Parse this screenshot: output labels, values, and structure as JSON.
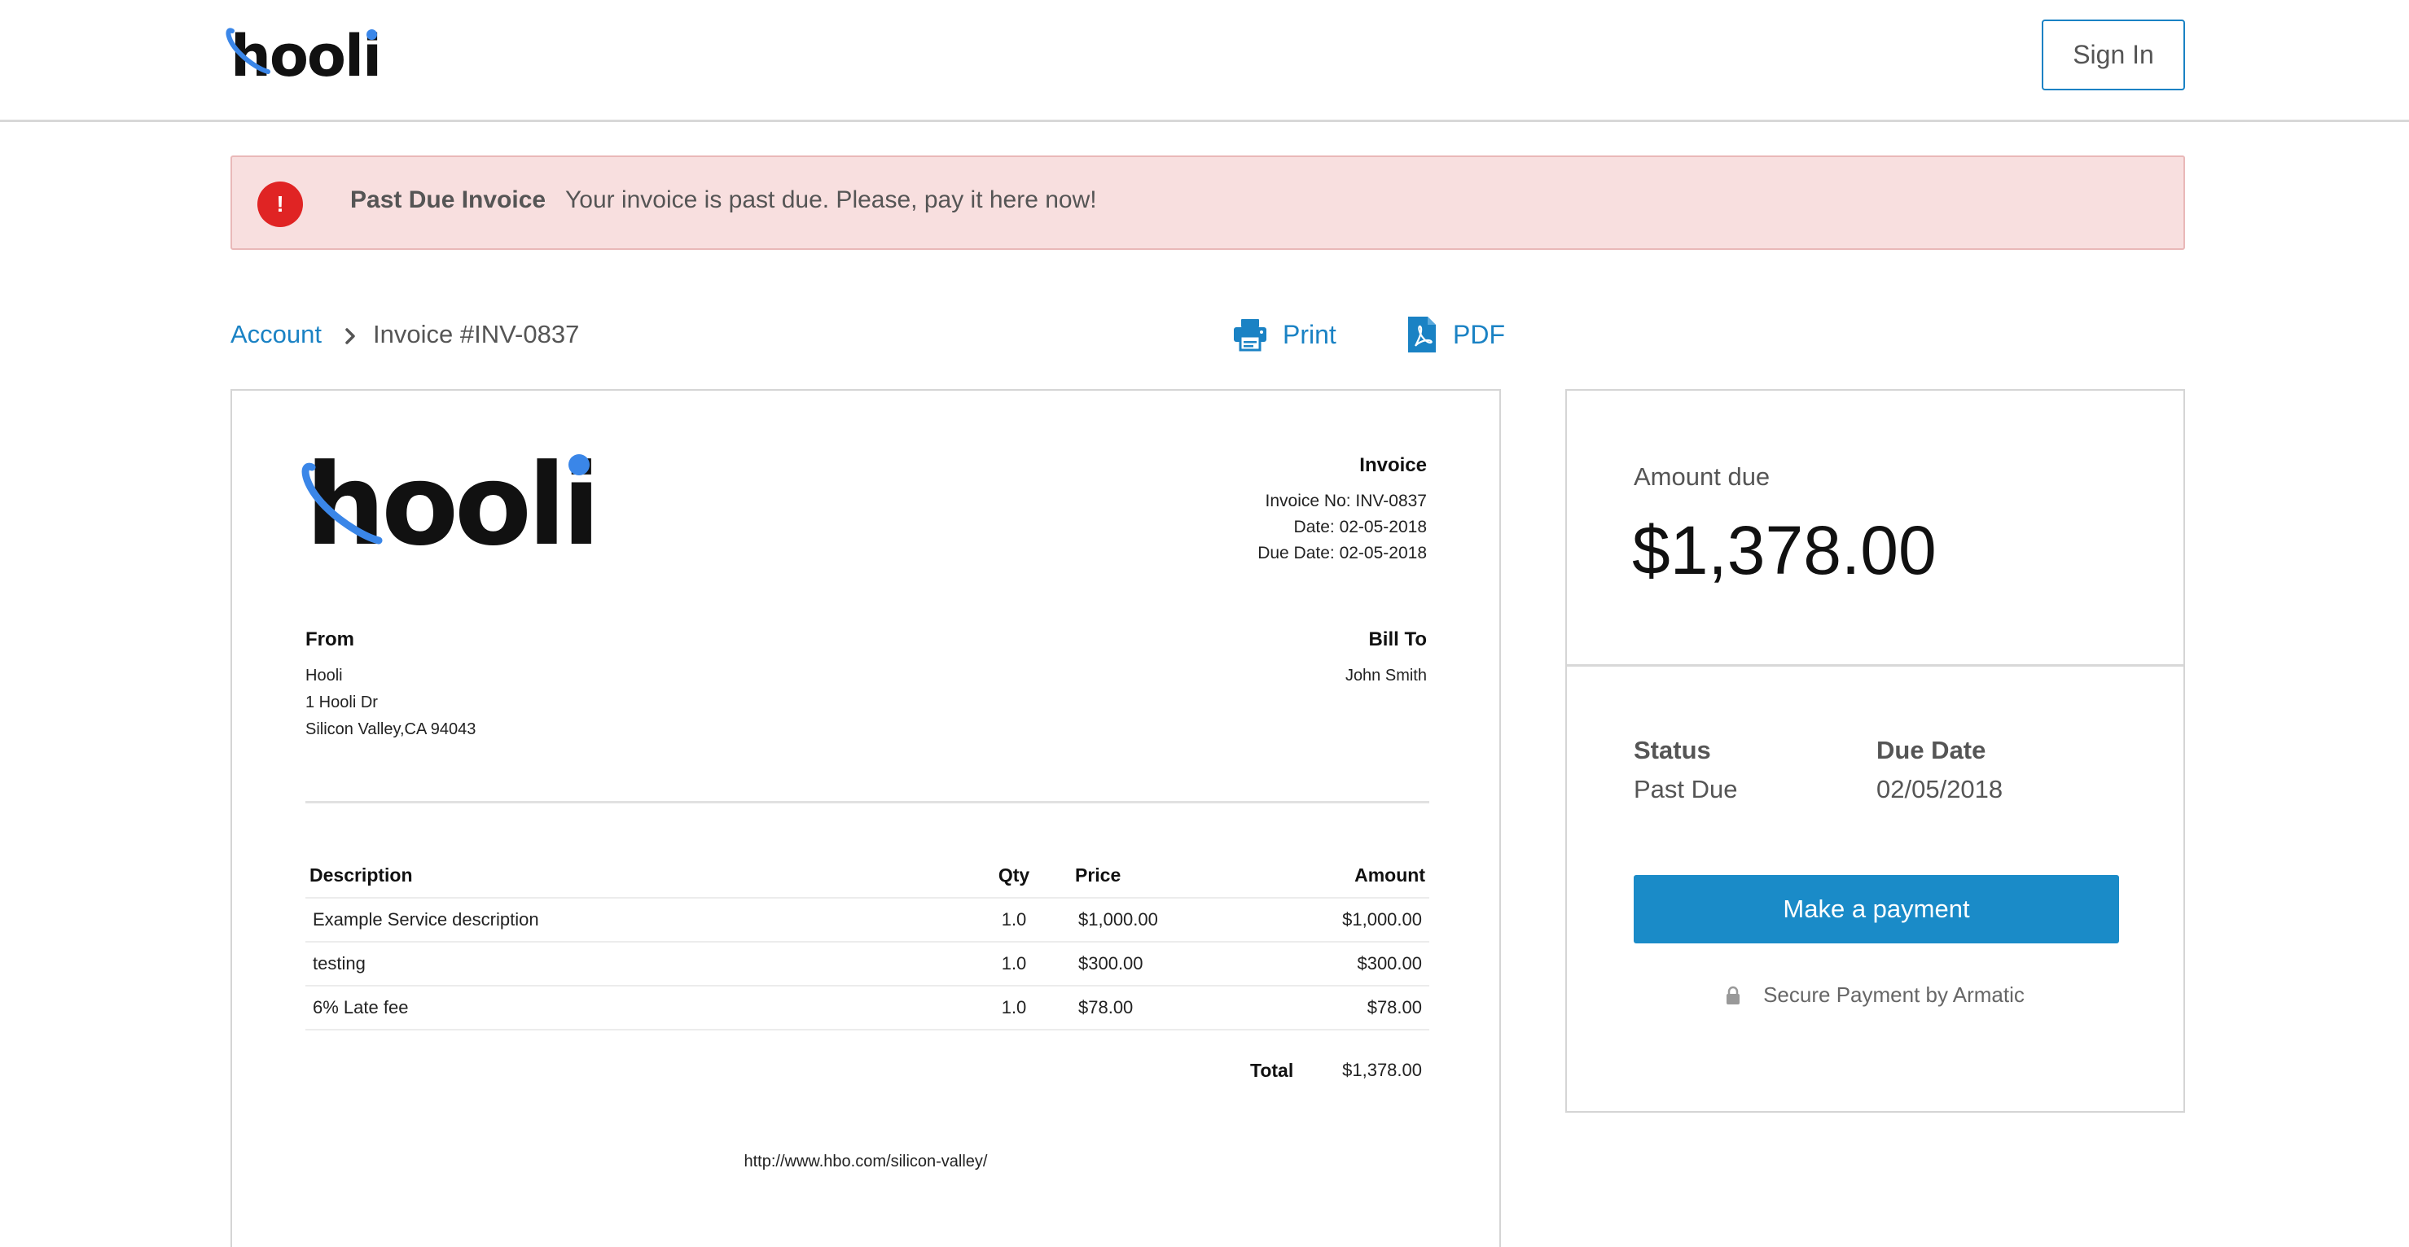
{
  "header": {
    "logo_text": "hooli",
    "sign_in_label": "Sign In"
  },
  "alert": {
    "icon_glyph": "!",
    "title": "Past Due Invoice",
    "message": "Your invoice is past due. Please, pay it here now!"
  },
  "breadcrumb": {
    "parent": "Account",
    "current": "Invoice #INV-0837"
  },
  "actions": {
    "print_label": "Print",
    "pdf_label": "PDF"
  },
  "invoice": {
    "logo_text": "hooli",
    "heading": "Invoice",
    "number_line": "Invoice No: INV-0837",
    "date_line": "Date: 02-05-2018",
    "due_date_line": "Due Date: 02-05-2018",
    "from": {
      "heading": "From",
      "name": "Hooli",
      "address1": "1 Hooli Dr",
      "address2": "Silicon Valley,CA 94043"
    },
    "bill_to": {
      "heading": "Bill To",
      "name": "John Smith"
    },
    "columns": {
      "description": "Description",
      "qty": "Qty",
      "price": "Price",
      "amount": "Amount"
    },
    "rows": [
      {
        "description": "Example Service description",
        "qty": "1.0",
        "price": "$1,000.00",
        "amount": "$1,000.00"
      },
      {
        "description": "testing",
        "qty": "1.0",
        "price": "$300.00",
        "amount": "$300.00"
      },
      {
        "description": "6% Late fee",
        "qty": "1.0",
        "price": "$78.00",
        "amount": "$78.00"
      }
    ],
    "total_label": "Total",
    "total_value": "$1,378.00",
    "footer_url": "http://www.hbo.com/silicon-valley/"
  },
  "payment": {
    "amount_label": "Amount due",
    "amount_value": "$1,378.00",
    "status_heading": "Status",
    "status_value": "Past Due",
    "due_date_heading": "Due Date",
    "due_date_value": "02/05/2018",
    "button_label": "Make a payment",
    "secure_text": "Secure Payment by Armatic"
  },
  "colors": {
    "accent": "#1a82c4",
    "button": "#1a8bc8",
    "alert_bg": "#f8dfdf",
    "alert_icon": "#e02424",
    "logo_accent": "#3a86e8"
  },
  "icons": [
    "alert-icon",
    "chevron-right-icon",
    "printer-icon",
    "pdf-icon",
    "lock-icon"
  ]
}
